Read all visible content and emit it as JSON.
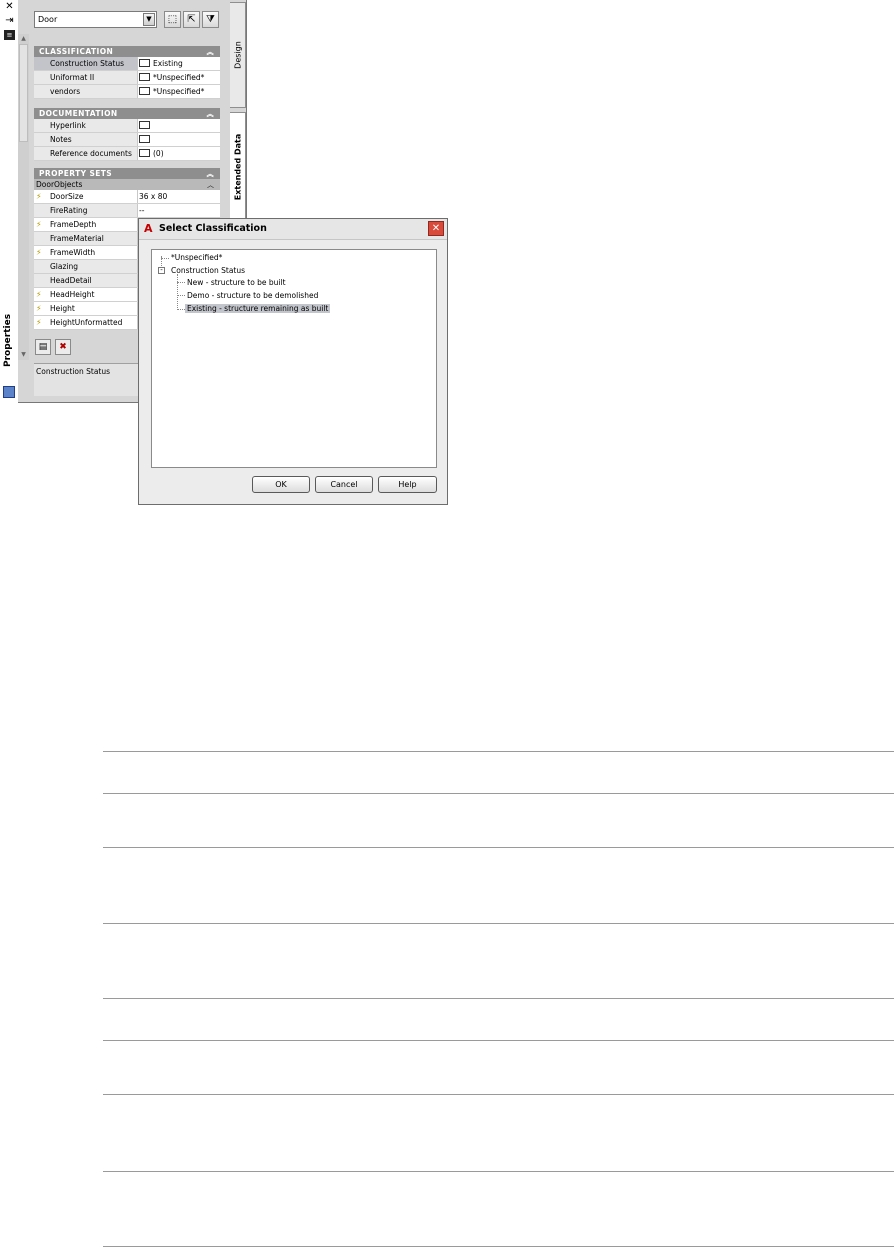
{
  "palette": {
    "title": "Properties",
    "object_type": "Door",
    "tabs": [
      "Design",
      "Extended Data"
    ],
    "sections": {
      "classification": {
        "header": "CLASSIFICATION",
        "rows": [
          {
            "label": "Construction Status",
            "value": "Existing"
          },
          {
            "label": "Uniformat II",
            "value": "*Unspecified*"
          },
          {
            "label": "vendors",
            "value": "*Unspecified*"
          }
        ]
      },
      "documentation": {
        "header": "DOCUMENTATION",
        "rows": [
          {
            "label": "Hyperlink",
            "value": ""
          },
          {
            "label": "Notes",
            "value": ""
          },
          {
            "label": "Reference documents",
            "value": "(0)"
          }
        ]
      },
      "property_sets": {
        "header": "PROPERTY SETS",
        "subheader": "DoorObjects",
        "rows": [
          {
            "label": "DoorSize",
            "value": "36 x 80"
          },
          {
            "label": "FireRating",
            "value": "--"
          },
          {
            "label": "FrameDepth",
            "value": ""
          },
          {
            "label": "FrameMaterial",
            "value": ""
          },
          {
            "label": "FrameWidth",
            "value": ""
          },
          {
            "label": "Glazing",
            "value": ""
          },
          {
            "label": "HeadDetail",
            "value": ""
          },
          {
            "label": "HeadHeight",
            "value": ""
          },
          {
            "label": "Height",
            "value": ""
          },
          {
            "label": "HeightUnformatted",
            "value": ""
          }
        ]
      }
    },
    "description": "Construction Status"
  },
  "dialog": {
    "title": "Select Classification",
    "tree": {
      "unspecified": "*Unspecified*",
      "group": "Construction Status",
      "children": [
        "New - structure to be built",
        "Demo - structure to be demolished",
        "Existing - structure remaining as built"
      ]
    },
    "buttons": {
      "ok": "OK",
      "cancel": "Cancel",
      "help": "Help"
    }
  }
}
